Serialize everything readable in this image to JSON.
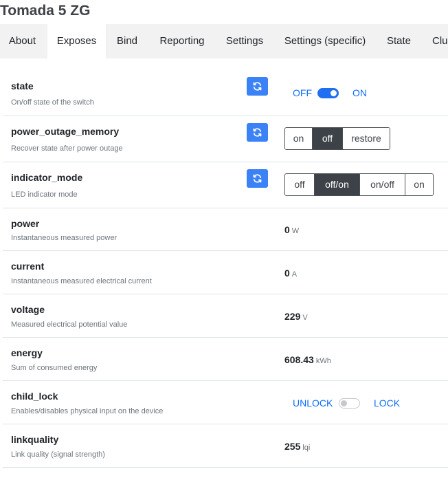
{
  "header": {
    "title": "Tomada 5 ZG"
  },
  "tabs": [
    {
      "label": "About",
      "active": false
    },
    {
      "label": "Exposes",
      "active": true
    },
    {
      "label": "Bind",
      "active": false
    },
    {
      "label": "Reporting",
      "active": false
    },
    {
      "label": "Settings",
      "active": false
    },
    {
      "label": "Settings (specific)",
      "active": false
    },
    {
      "label": "State",
      "active": false
    },
    {
      "label": "Clu",
      "active": false
    }
  ],
  "exposes": {
    "state": {
      "name": "state",
      "description": "On/off state of the switch",
      "off_label": "OFF",
      "on_label": "ON",
      "value": "ON"
    },
    "power_outage_memory": {
      "name": "power_outage_memory",
      "description": "Recover state after power outage",
      "options": [
        "on",
        "off",
        "restore"
      ],
      "selected": "off"
    },
    "indicator_mode": {
      "name": "indicator_mode",
      "description": "LED indicator mode",
      "options": [
        "off",
        "off/on",
        "on/off",
        "on"
      ],
      "selected": "off/on"
    },
    "power": {
      "name": "power",
      "description": "Instantaneous measured power",
      "value": "0",
      "unit": "W"
    },
    "current": {
      "name": "current",
      "description": "Instantaneous measured electrical current",
      "value": "0",
      "unit": "A"
    },
    "voltage": {
      "name": "voltage",
      "description": "Measured electrical potential value",
      "value": "229",
      "unit": "V"
    },
    "energy": {
      "name": "energy",
      "description": "Sum of consumed energy",
      "value": "608.43",
      "unit": "kWh"
    },
    "child_lock": {
      "name": "child_lock",
      "description": "Enables/disables physical input on the device",
      "off_label": "UNLOCK",
      "on_label": "LOCK",
      "value": "UNLOCK"
    },
    "linkquality": {
      "name": "linkquality",
      "description": "Link quality (signal strength)",
      "value": "255",
      "unit": "lqi"
    }
  },
  "colors": {
    "accent": "#3b82f6",
    "switch_on": "#1f6ff0",
    "link": "#0d6efd",
    "selected_option": "#3d4248"
  },
  "icons": {
    "refresh": "refresh-icon"
  }
}
